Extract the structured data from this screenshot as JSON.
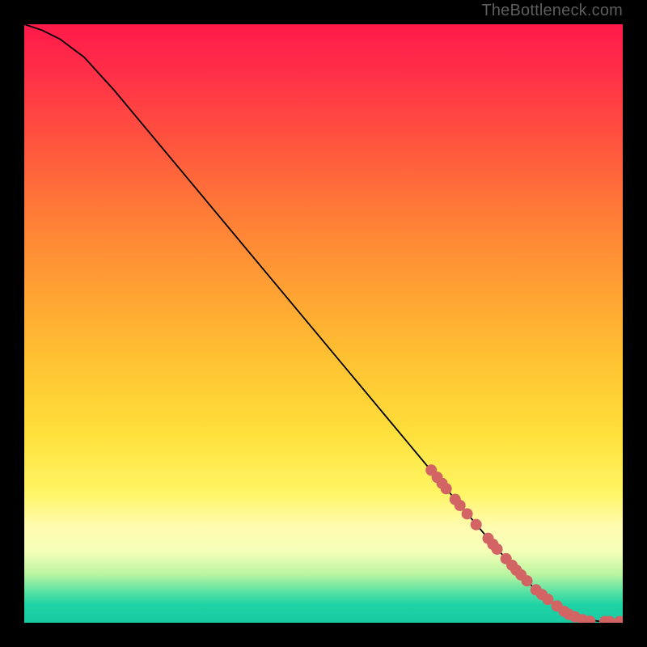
{
  "watermark": "TheBottleneck.com",
  "chart_data": {
    "type": "line",
    "title": "",
    "xlabel": "",
    "ylabel": "",
    "xlim": [
      0,
      100
    ],
    "ylim": [
      0,
      100
    ],
    "grid": false,
    "legend": false,
    "series": [
      {
        "name": "bottleneck-curve",
        "x": [
          0,
          3,
          6,
          10,
          15,
          20,
          30,
          40,
          50,
          60,
          70,
          78,
          82,
          85,
          88,
          90,
          92,
          94,
          96,
          98,
          100
        ],
        "y": [
          100,
          99,
          97.5,
          94.5,
          89,
          83,
          71,
          59,
          47,
          35,
          23,
          13.5,
          9,
          6,
          3.5,
          2,
          1,
          0.5,
          0.25,
          0.15,
          0.1
        ]
      }
    ],
    "markers": {
      "series": "bottleneck-curve",
      "color": "#d36464",
      "radius": 7,
      "points_xy": [
        [
          68,
          25.5
        ],
        [
          69,
          24.3
        ],
        [
          69.8,
          23.3
        ],
        [
          70.5,
          22.4
        ],
        [
          72,
          20.6
        ],
        [
          72.8,
          19.6
        ],
        [
          74,
          18.2
        ],
        [
          75.5,
          16.4
        ],
        [
          77.5,
          14.1
        ],
        [
          78.3,
          13.1
        ],
        [
          79,
          12.3
        ],
        [
          80.5,
          10.7
        ],
        [
          81.5,
          9.6
        ],
        [
          82.2,
          8.8
        ],
        [
          83,
          8
        ],
        [
          84,
          7
        ],
        [
          85.5,
          5.5
        ],
        [
          86.5,
          4.7
        ],
        [
          87.5,
          3.9
        ],
        [
          89,
          2.8
        ],
        [
          90.2,
          1.9
        ],
        [
          91,
          1.4
        ],
        [
          92,
          1
        ],
        [
          93.3,
          0.5
        ],
        [
          94.5,
          0.25
        ],
        [
          97,
          0.2
        ],
        [
          97.8,
          0.2
        ],
        [
          99.5,
          0.2
        ]
      ]
    }
  }
}
